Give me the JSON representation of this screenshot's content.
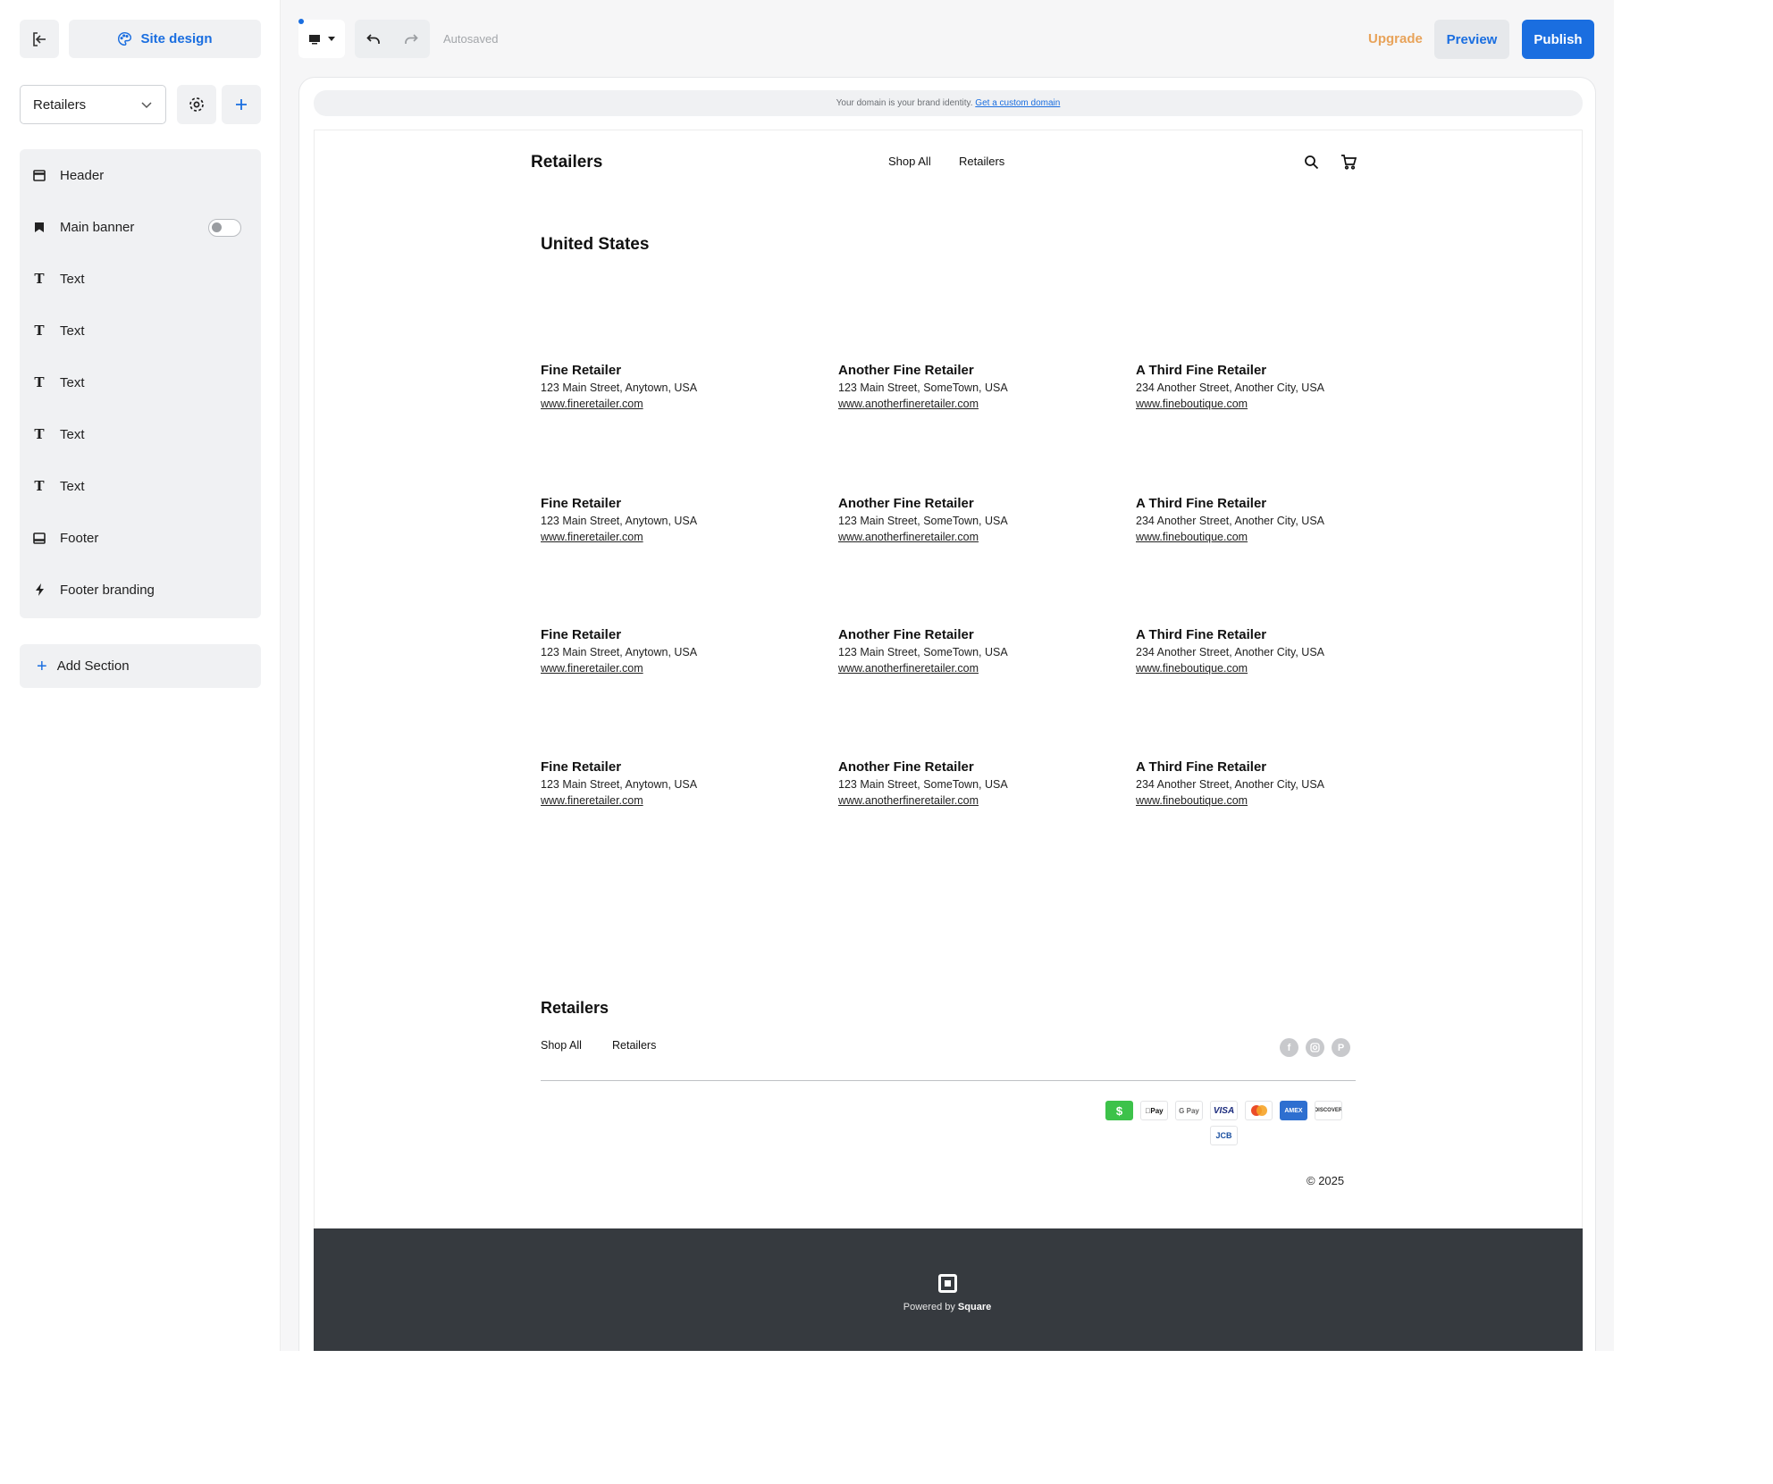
{
  "sidebar": {
    "design_label": "Site design",
    "page_select": "Retailers",
    "sections": [
      {
        "label": "Header",
        "icon": "header-icon"
      },
      {
        "label": "Main banner",
        "icon": "bookmark-icon",
        "toggle": "off"
      },
      {
        "label": "Text",
        "icon": "text-icon"
      },
      {
        "label": "Text",
        "icon": "text-icon"
      },
      {
        "label": "Text",
        "icon": "text-icon"
      },
      {
        "label": "Text",
        "icon": "text-icon"
      },
      {
        "label": "Text",
        "icon": "text-icon"
      },
      {
        "label": "Footer",
        "icon": "footer-icon"
      },
      {
        "label": "Footer branding",
        "icon": "bolt-icon"
      }
    ],
    "add_section": "Add Section"
  },
  "toolbar": {
    "autosaved": "Autosaved",
    "upgrade": "Upgrade",
    "preview": "Preview",
    "publish": "Publish"
  },
  "domain_bar": {
    "text": "Your domain is your brand identity.",
    "link": "Get a custom domain"
  },
  "site": {
    "logo": "Retailers",
    "nav": [
      "Shop All",
      "Retailers"
    ],
    "country": "United States",
    "retailers": [
      {
        "name": "Fine Retailer",
        "address": "123 Main Street, Anytown, USA",
        "url": "www.fineretailer.com"
      },
      {
        "name": "Another Fine Retailer",
        "address": "123 Main Street, SomeTown, USA",
        "url": "www.anotherfineretailer.com"
      },
      {
        "name": "A Third Fine Retailer",
        "address": "234 Another Street, Another City, USA",
        "url": "www.fineboutique.com"
      }
    ],
    "footer": {
      "title": "Retailers",
      "links": [
        "Shop All",
        "Retailers"
      ],
      "payments": [
        {
          "name": "cash-app",
          "label": "$"
        },
        {
          "name": "apple-pay",
          "label": "Pay"
        },
        {
          "name": "google-pay",
          "label": "G Pay"
        },
        {
          "name": "visa",
          "label": "VISA"
        },
        {
          "name": "mastercard",
          "label": ""
        },
        {
          "name": "amex",
          "label": "AMEX"
        },
        {
          "name": "discover",
          "label": "DISCOVER"
        },
        {
          "name": "jcb",
          "label": "JCB"
        }
      ],
      "copyright": "© 2025"
    },
    "branding": {
      "powered_by": "Powered by",
      "brand": "Square"
    }
  },
  "colors": {
    "accent": "#1a6ee0",
    "upgrade": "#e8a35a",
    "branding_bg": "#363a3f"
  }
}
